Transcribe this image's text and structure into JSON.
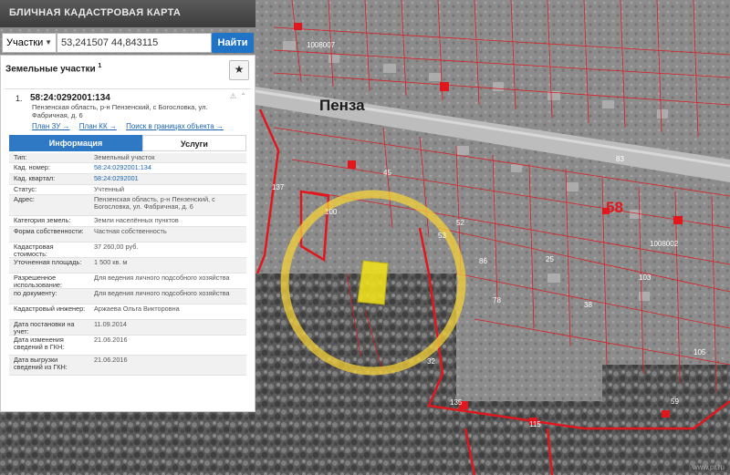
{
  "header": {
    "title": "БЛИЧНАЯ КАДАСТРОВАЯ КАРТА"
  },
  "search": {
    "type_label": "Участки",
    "coords_value": "53,241507 44,843115",
    "find_label": "Найти"
  },
  "panel": {
    "title": "Земельные участки",
    "title_sup": "1",
    "star": "★",
    "card": {
      "index": "1.",
      "cadastral_number": "58:24:0292001:134",
      "address": "Пензенская область, р-н Пензенский, с Богословка, ул. Фабричная, д. 6",
      "tool_icons": "⚠ ⌃",
      "links": [
        "План ЗУ →",
        "План КК →",
        "Поиск в границах объекта →"
      ],
      "tabs": [
        "Информация",
        "Услуги"
      ],
      "rows": [
        {
          "label": "Тип:",
          "value": "Земельный участок"
        },
        {
          "label": "Кад. номер:",
          "value": "58:24:0292001:134",
          "link": true
        },
        {
          "label": "Кад. квартал:",
          "value": "58:24:0292001",
          "link": true
        },
        {
          "label": "Статус:",
          "value": "Учтенный"
        },
        {
          "label": "Адрес:",
          "value": "Пензенская область, р-н Пензенский, с Богословка, ул. Фабричная, д. 6"
        },
        {
          "label": "Категория земель:",
          "value": "Земли населённых пунктов"
        },
        {
          "label": "Форма собственности:",
          "value": "Частная собственность"
        },
        {
          "label": "Кадастровая стоимость:",
          "value": "37 260,00 руб."
        },
        {
          "label": "Уточненная площадь:",
          "value": "1 500 кв. м"
        },
        {
          "label": "Разрешенное использование:",
          "value": "Для ведения личного подсобного хозяйства"
        },
        {
          "label": "по документу:",
          "value": "Для ведения личного подсобного хозяйства"
        },
        {
          "label": "Кадастровый инженер:",
          "value": "Аржаева Ольга Викторовна"
        },
        {
          "label": "Дата постановки на учет:",
          "value": "11.09.2014"
        },
        {
          "label": "Дата изменения сведений в ГКН:",
          "value": "21.06.2016"
        },
        {
          "label": "Дата выгрузки сведений из ГКН:",
          "value": "21.06.2016"
        }
      ]
    }
  },
  "map": {
    "city_label": "Пенза",
    "block_labels": [
      "1008007",
      "1008002"
    ],
    "district_number": "58",
    "parcel_numbers": [
      "137",
      "100",
      "53",
      "86",
      "78",
      "25",
      "52",
      "38",
      "135",
      "115",
      "105",
      "59",
      "83",
      "103",
      "45",
      "32"
    ],
    "watermark": "www.pr.ru"
  },
  "colors": {
    "accent": "#2f78c4",
    "boundary": "#e0181e",
    "highlight": "#f5d23a"
  }
}
